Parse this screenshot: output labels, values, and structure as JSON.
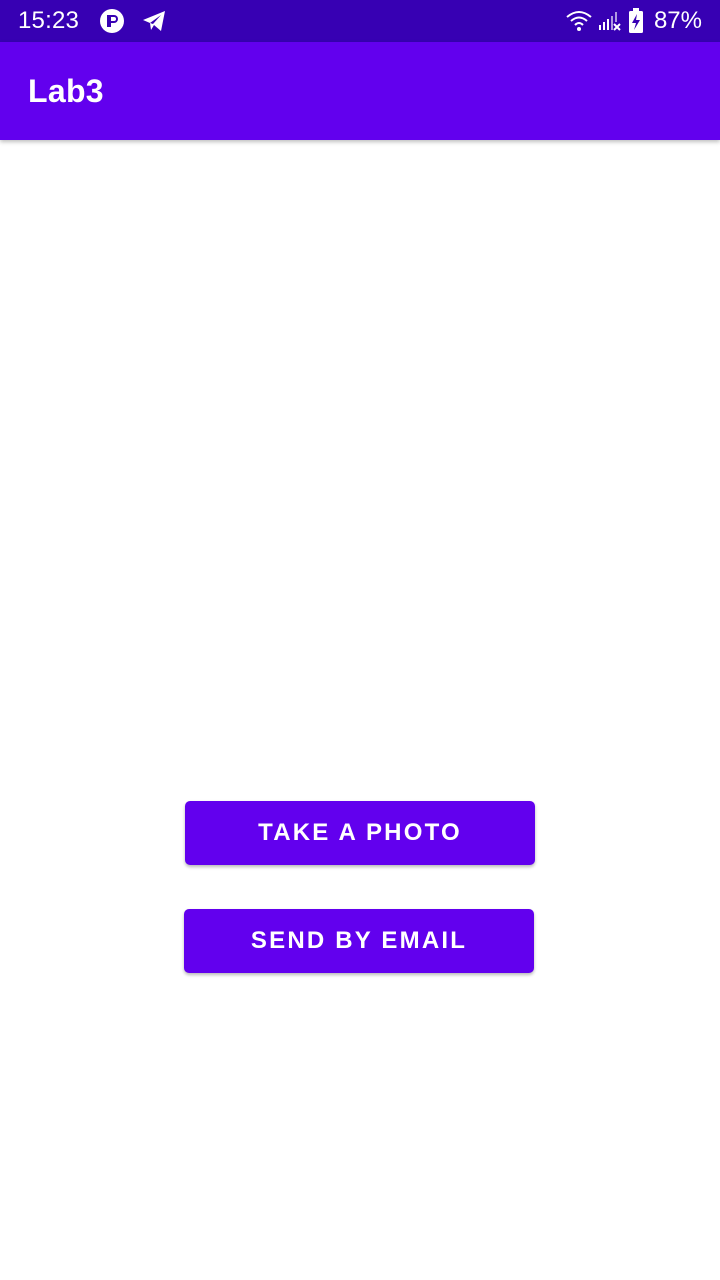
{
  "status_bar": {
    "time": "15:23",
    "battery": "87%",
    "icons_left": [
      "app-notification-icon",
      "telegram-icon"
    ],
    "icons_right": [
      "wifi-icon",
      "signal-no-service-icon",
      "battery-charging-icon"
    ],
    "background": "#3700b3"
  },
  "app_bar": {
    "title": "Lab3",
    "background": "#6200ee"
  },
  "main": {
    "take_photo_label": "TAKE A PHOTO",
    "send_email_label": "SEND BY EMAIL",
    "button_color": "#6200ee"
  }
}
